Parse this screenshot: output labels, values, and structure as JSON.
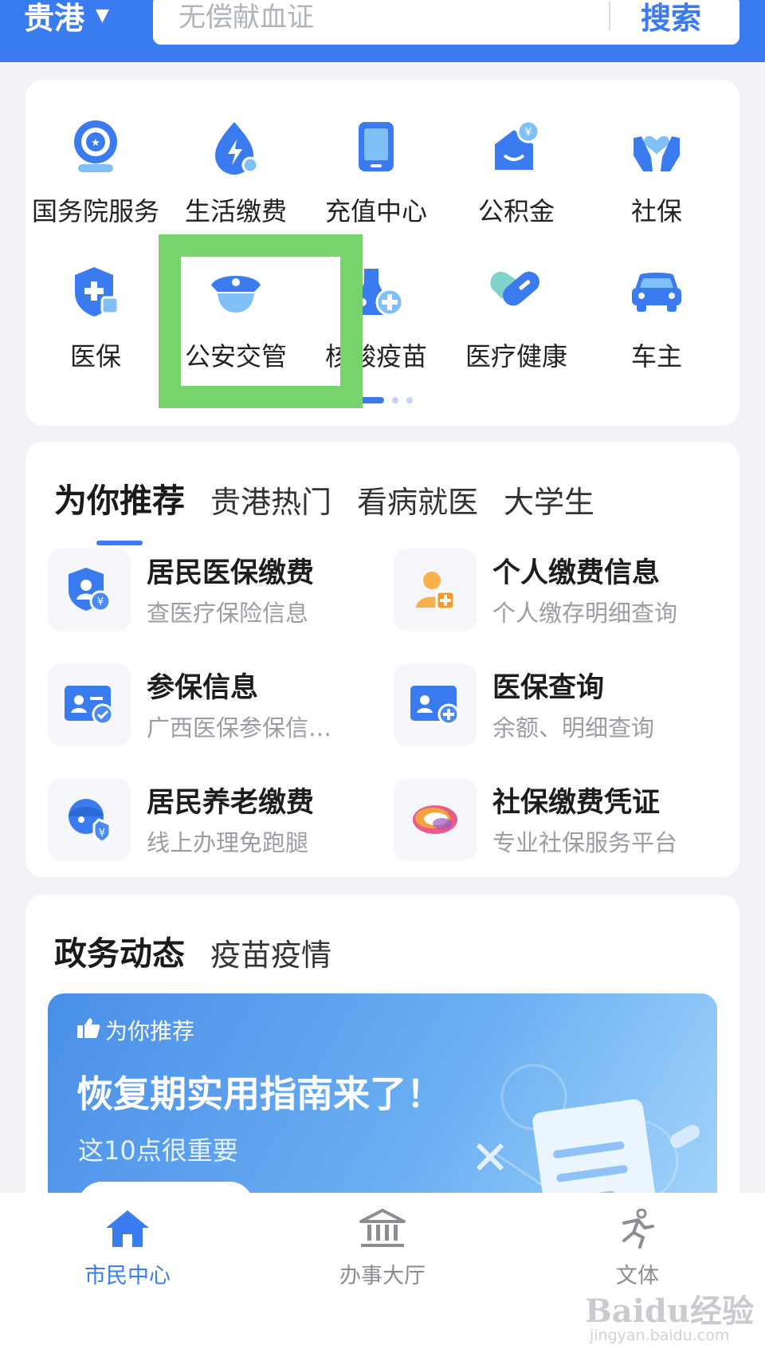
{
  "header": {
    "city": "贵港",
    "search_placeholder": "无偿献血证",
    "search_button": "搜索"
  },
  "services": [
    {
      "label": "国务院服务",
      "icon": "state-council-icon"
    },
    {
      "label": "生活缴费",
      "icon": "utility-bill-icon"
    },
    {
      "label": "充值中心",
      "icon": "phone-topup-icon"
    },
    {
      "label": "公积金",
      "icon": "housing-fund-icon"
    },
    {
      "label": "社保",
      "icon": "social-security-icon"
    },
    {
      "label": "医保",
      "icon": "medical-insurance-icon"
    },
    {
      "label": "公安交管",
      "icon": "police-cap-icon"
    },
    {
      "label": "核酸疫苗",
      "icon": "vaccine-icon"
    },
    {
      "label": "医疗健康",
      "icon": "health-icon"
    },
    {
      "label": "车主",
      "icon": "car-icon"
    }
  ],
  "recommend": {
    "tabs": [
      "为你推荐",
      "贵港热门",
      "看病就医",
      "大学生"
    ],
    "active_tab": 0,
    "items": [
      {
        "title": "居民医保缴费",
        "subtitle": "查医疗保险信息",
        "icon": "medical-payment-icon"
      },
      {
        "title": "个人缴费信息",
        "subtitle": "个人缴存明细查询",
        "icon": "personal-payment-icon"
      },
      {
        "title": "参保信息",
        "subtitle": "广西医保参保信…",
        "icon": "insurance-info-icon"
      },
      {
        "title": "医保查询",
        "subtitle": "余额、明细查询",
        "icon": "insurance-query-icon"
      },
      {
        "title": "居民养老缴费",
        "subtitle": "线上办理免跑腿",
        "icon": "pension-payment-icon"
      },
      {
        "title": "社保缴费凭证",
        "subtitle": "专业社保服务平台",
        "icon": "social-voucher-icon"
      }
    ]
  },
  "news": {
    "tabs": [
      "政务动态",
      "疫苗疫情"
    ],
    "active_tab": 0,
    "banner": {
      "tag": "为你推荐",
      "title": "恢复期实用指南来了！",
      "subtitle": "这10点很重要"
    }
  },
  "bottom_nav": [
    {
      "label": "市民中心",
      "icon": "home-icon",
      "active": true
    },
    {
      "label": "办事大厅",
      "icon": "hall-icon",
      "active": false
    },
    {
      "label": "文体",
      "icon": "sports-icon",
      "active": false
    }
  ],
  "watermark": {
    "text": "Baidu经验",
    "url": "jingyan.baidu.com"
  },
  "colors": {
    "primary": "#3a7cf0",
    "highlight": "#76d36d"
  }
}
